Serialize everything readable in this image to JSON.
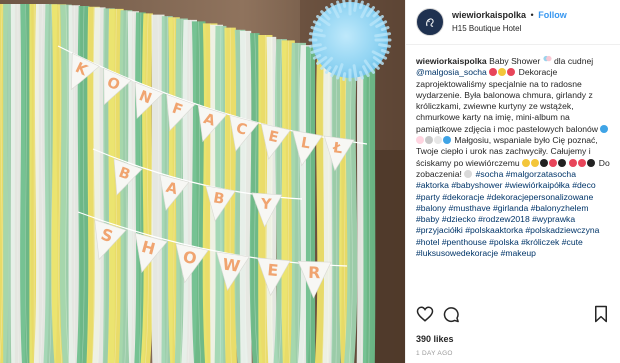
{
  "media": {
    "bunting_top": [
      "K",
      "O",
      "N",
      "F",
      "A",
      "C",
      "E",
      "L",
      "Ł"
    ],
    "bunting_mid": [
      "B",
      "A",
      "B",
      "Y"
    ],
    "bunting_bottom": [
      "S",
      "H",
      "O",
      "W",
      "E",
      "R"
    ],
    "colors": {
      "wall": "#8a6e58",
      "pompom": "#8fd3f2",
      "flag": "#f7f7f4",
      "letter": "#f0a470",
      "streamer_yellow": "#f2e66b",
      "streamer_mint": "#9fd6b2",
      "streamer_green": "#6dbf8c",
      "streamer_white": "#eef2ee"
    }
  },
  "header": {
    "username": "wiewiorkaispolka",
    "separator": "•",
    "follow": "Follow",
    "location": "H15 Boutique Hotel",
    "avatar_icon": "squirrel-logo-icon"
  },
  "caption": {
    "username": "wiewiorkaispolka",
    "t1": " Baby Shower",
    "t2": " dla cudnej ",
    "mention1": "@malgosia_socha",
    "t3": " Dekoracje zaprojektowaliśmy specjalnie na to radosne wydarzenie. Była balonowa chmura, girlandy z króliczkami, zwiewne kurtyny ze wstążek, chmurkowe karty na imię, mini-album na pamiątkowe zdjęcia i moc pastelowych balonów",
    "t4": " Małgosiu, wspaniale było Cię poznać, Twoje ciepło i urok nas zachwyciły. Całujemy i ściskamy po wiewiórczemu",
    "t5": " Do zobaczenia!",
    "t6": " ",
    "tags": [
      "#socha",
      "#malgorzatasocha",
      "#aktorka",
      "#babyshower",
      "#wiewiórkaipółka",
      "#deco",
      "#party",
      "#dekoracje",
      "#dekoracjepersonalizowane",
      "#balony",
      "#musthave",
      "#girlanda",
      "#balonyzhelem",
      "#baby",
      "#dziecko",
      "#rodzew2018",
      "#wyprawka",
      "#przyjaciółki",
      "#polskaaktorka",
      "#polskadziewczyna",
      "#hotel",
      "#penthouse",
      "#polska",
      "#króliczek",
      "#cute",
      "#luksusowedekoracje",
      "#makeup"
    ]
  },
  "actions": {
    "like_icon": "heart-icon",
    "comment_icon": "comment-icon",
    "save_icon": "bookmark-icon"
  },
  "likes": "390 likes",
  "age": "1 DAY AGO"
}
